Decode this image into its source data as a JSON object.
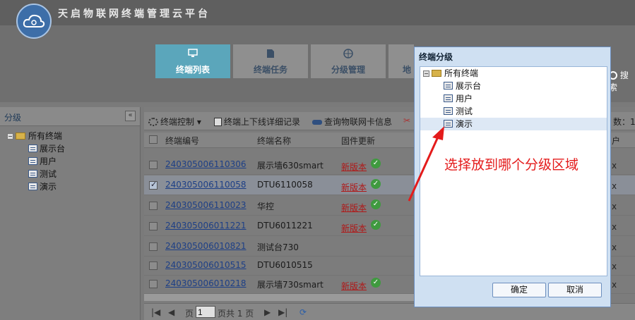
{
  "app": {
    "title": "天启物联网终端管理云平台"
  },
  "nav": [
    {
      "label": "终端列表",
      "icon": "monitor-icon",
      "active": true
    },
    {
      "label": "终端任务",
      "icon": "document-gear-icon",
      "active": false
    },
    {
      "label": "分级管理",
      "icon": "globe-icon",
      "active": false
    },
    {
      "label": "地",
      "icon": "map-icon",
      "active": false
    }
  ],
  "search": {
    "label": "搜索"
  },
  "left_panel": {
    "title": "分级",
    "collapse_icon": "double-chevron-left-icon",
    "tree": {
      "root": "所有终端",
      "children": [
        "展示台",
        "用户",
        "测试",
        "演示"
      ]
    }
  },
  "toolbar": {
    "items": [
      "终端控制",
      "终端上下线详细记录",
      "查询物联网卡信息"
    ],
    "total_label": "数：1"
  },
  "grid": {
    "columns": [
      "终端编号",
      "终端名称",
      "固件更新",
      "户"
    ],
    "rows": [
      {
        "code": "240305006110306",
        "name": "展示墙630smart",
        "firmware": "新版本",
        "ok": true,
        "checked": false,
        "tail": "x"
      },
      {
        "code": "240305006110058",
        "name": "DTU6110058",
        "firmware": "新版本",
        "ok": true,
        "checked": true,
        "tail": "x"
      },
      {
        "code": "240305006110023",
        "name": "华控",
        "firmware": "新版本",
        "ok": true,
        "checked": false,
        "tail": "x"
      },
      {
        "code": "240305006011221",
        "name": "DTU6011221",
        "firmware": "新版本",
        "ok": true,
        "checked": false,
        "tail": "x"
      },
      {
        "code": "240305006010821",
        "name": "测试台730",
        "firmware": "",
        "ok": false,
        "checked": false,
        "tail": "x"
      },
      {
        "code": "240305006010515",
        "name": "DTU6010515",
        "firmware": "",
        "ok": false,
        "checked": false,
        "tail": "x"
      },
      {
        "code": "240305006010218",
        "name": "展示墙730smart",
        "firmware": "新版本",
        "ok": true,
        "checked": false,
        "tail": "x"
      }
    ]
  },
  "pager": {
    "page_prefix": "页",
    "page": "1",
    "page_suffix": "页共 1 页"
  },
  "dialog": {
    "title": "终端分级",
    "tree": {
      "root": "所有终端",
      "children": [
        "展示台",
        "用户",
        "测试",
        "演示"
      ],
      "selected": "演示"
    },
    "ok_label": "确定",
    "cancel_label": "取消"
  },
  "annotation": {
    "text": "选择放到哪个分级区域",
    "color": "#e41b1b"
  }
}
